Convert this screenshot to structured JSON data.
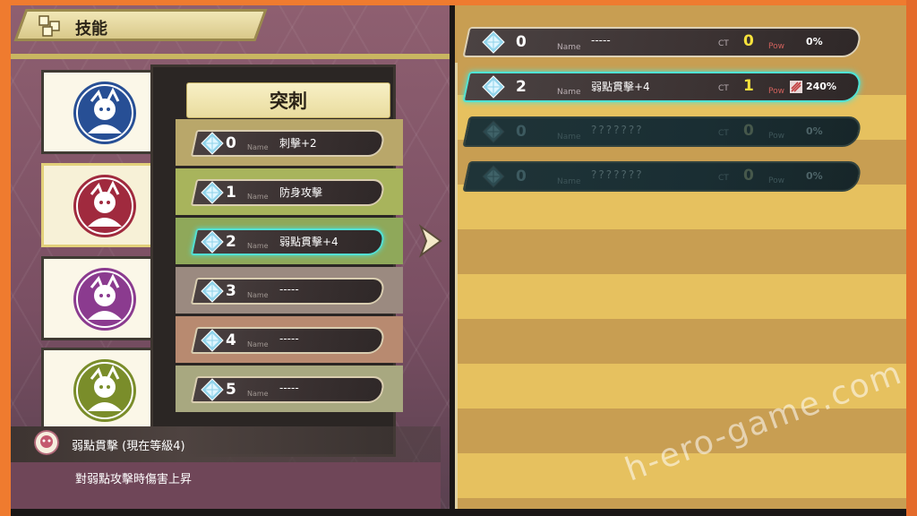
{
  "header": {
    "title": "技能"
  },
  "characters": [
    {
      "color": "#274f95",
      "active": false
    },
    {
      "color": "#a02a3e",
      "active": true
    },
    {
      "color": "#8b3b8f",
      "active": false
    },
    {
      "color": "#7a8d2a",
      "active": false
    }
  ],
  "skill_category": "突刺",
  "skill_list": [
    {
      "num": "0",
      "name_label": "Name",
      "name": "刺擊+2",
      "band": "#b9a76a",
      "selected": false
    },
    {
      "num": "1",
      "name_label": "Name",
      "name": "防身攻擊",
      "band": "#a8b45c",
      "selected": false
    },
    {
      "num": "2",
      "name_label": "Name",
      "name": "弱點貫擊+4",
      "band": "#8fa85a",
      "selected": true
    },
    {
      "num": "3",
      "name_label": "Name",
      "name": "-----",
      "band": "#9b8a80",
      "selected": false
    },
    {
      "num": "4",
      "name_label": "Name",
      "name": "-----",
      "band": "#b88a70",
      "selected": false
    },
    {
      "num": "5",
      "name_label": "Name",
      "name": "-----",
      "band": "#a8a880",
      "selected": false
    }
  ],
  "info": {
    "title": "弱點貫擊 (現在等級4)",
    "description": "對弱點攻擊時傷害上昇"
  },
  "equipped_slots": [
    {
      "num": "0",
      "name_label": "Name",
      "name": "-----",
      "ct_label": "CT",
      "ct": "0",
      "pow_label": "Pow",
      "pow": "0%",
      "state": "normal"
    },
    {
      "num": "2",
      "name_label": "Name",
      "name": "弱點貫擊+4",
      "ct_label": "CT",
      "ct": "1",
      "pow_label": "Pow",
      "pow": "240%",
      "state": "selected"
    },
    {
      "num": "0",
      "name_label": "Name",
      "name": "???????",
      "ct_label": "CT",
      "ct": "0",
      "pow_label": "Pow",
      "pow": "0%",
      "state": "locked"
    },
    {
      "num": "0",
      "name_label": "Name",
      "name": "???????",
      "ct_label": "CT",
      "ct": "0",
      "pow_label": "Pow",
      "pow": "0%",
      "state": "locked"
    }
  ],
  "watermark": "h-ero-game.com"
}
